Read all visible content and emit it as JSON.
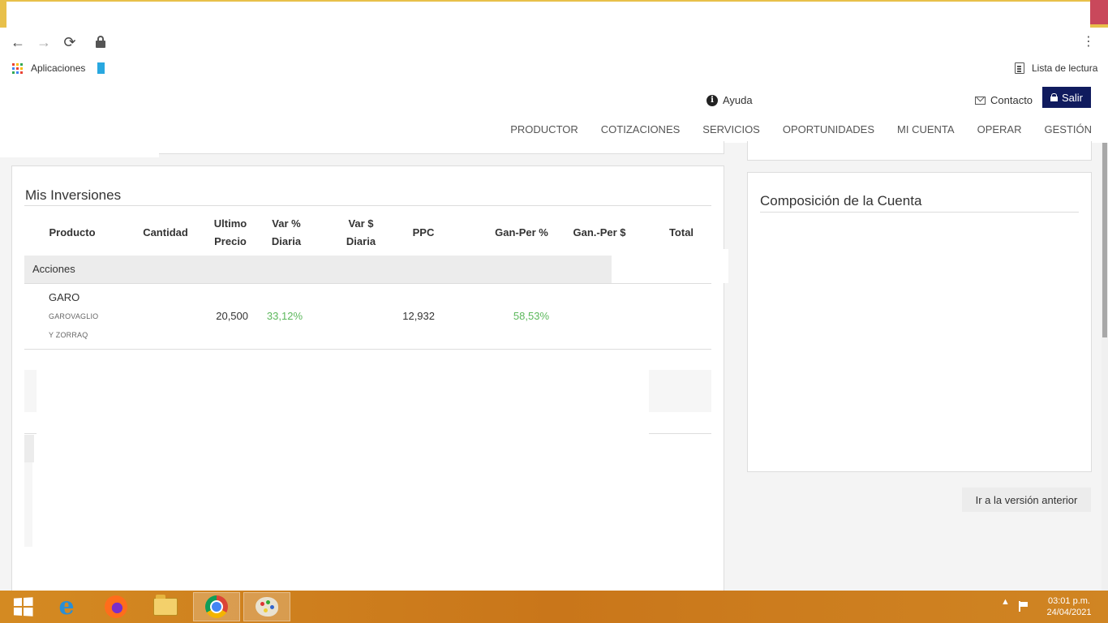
{
  "browser": {
    "bookmarks": [
      {
        "label": "Aplicaciones",
        "icon": "apps-grid-icon"
      }
    ],
    "reading_list_label": "Lista de lectura"
  },
  "header": {
    "help_label": "Ayuda",
    "contact_label": "Contacto",
    "logout_label": "Salir",
    "nav": [
      "PRODUCTOR",
      "COTIZACIONES",
      "SERVICIOS",
      "OPORTUNIDADES",
      "MI CUENTA",
      "OPERAR",
      "GESTIÓN"
    ]
  },
  "investments": {
    "title": "Mis Inversiones",
    "columns": [
      {
        "l1": "Producto",
        "l2": ""
      },
      {
        "l1": "Cantidad",
        "l2": ""
      },
      {
        "l1": "Ultimo",
        "l2": "Precio"
      },
      {
        "l1": "Var %",
        "l2": "Diaria"
      },
      {
        "l1": "Var $",
        "l2": "Diaria"
      },
      {
        "l1": "PPC",
        "l2": ""
      },
      {
        "l1": "Gan-Per %",
        "l2": ""
      },
      {
        "l1": "Gan.-Per $",
        "l2": ""
      },
      {
        "l1": "Total",
        "l2": ""
      }
    ],
    "group_label": "Acciones",
    "rows": [
      {
        "ticker": "GARO",
        "name_line1": "GAROVAGLIO",
        "name_line2": "Y ZORRAQ",
        "last_price": "20,500",
        "var_pct": "33,12%",
        "ppc": "12,932",
        "gain_pct": "58,53%"
      }
    ]
  },
  "composition": {
    "title": "Composición de la Cuenta"
  },
  "prev_version_label": "Ir a la versión anterior",
  "taskbar": {
    "time": "03:01 p.m.",
    "date": "24/04/2021"
  },
  "colors": {
    "logout_bg": "#101b5e",
    "positive": "#5cb85c",
    "taskbar": "#d48a22"
  }
}
